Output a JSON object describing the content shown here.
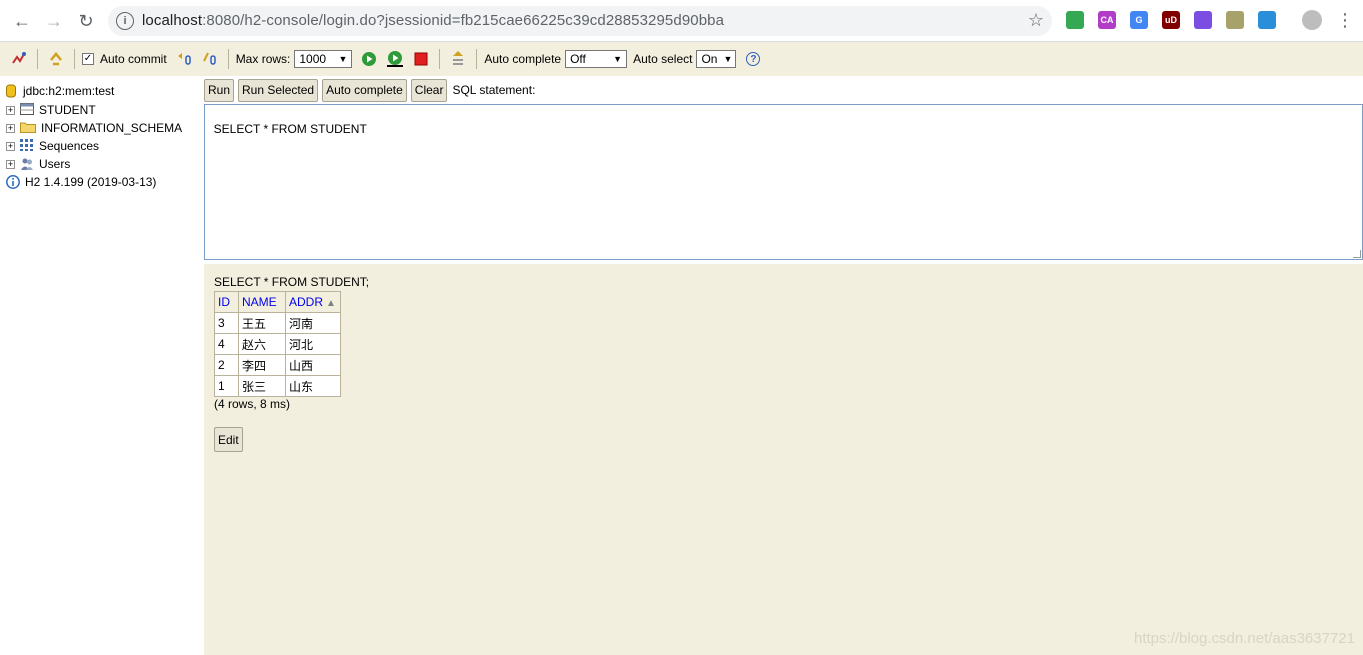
{
  "browser": {
    "url_host": "localhost",
    "url_rest": ":8080/h2-console/login.do?jsessionid=fb215cae66225c39cd28853295d90bba",
    "extensions": [
      {
        "name": "drive-extension-icon",
        "color": "#34a853",
        "label": ""
      },
      {
        "name": "ca-extension-icon",
        "color": "#b03cc8",
        "label": "CA"
      },
      {
        "name": "translate-extension-icon",
        "color": "#4285f4",
        "label": "G"
      },
      {
        "name": "ublock-extension-icon",
        "color": "#800000",
        "label": "uD"
      },
      {
        "name": "shield-extension-icon",
        "color": "#7b4de2",
        "label": ""
      },
      {
        "name": "notes-extension-icon",
        "color": "#a7a26a",
        "label": ""
      },
      {
        "name": "video-extension-icon",
        "color": "#2a8fd8",
        "label": ""
      }
    ]
  },
  "toolbar": {
    "auto_commit_label": "Auto commit",
    "max_rows_label": "Max rows:",
    "max_rows_value": "1000",
    "auto_complete_label": "Auto complete",
    "auto_complete_value": "Off",
    "auto_select_label": "Auto select",
    "auto_select_value": "On",
    "help_glyph": "?"
  },
  "tree": {
    "connection": "jdbc:h2:mem:test",
    "items": [
      {
        "label": "STUDENT"
      },
      {
        "label": "INFORMATION_SCHEMA"
      },
      {
        "label": "Sequences"
      },
      {
        "label": "Users"
      }
    ],
    "version": "H2 1.4.199 (2019-03-13)"
  },
  "query": {
    "run_label": "Run",
    "run_selected_label": "Run Selected",
    "auto_complete_label": "Auto complete",
    "clear_label": "Clear",
    "sql_statement_label": "SQL statement:",
    "sql_text": "SELECT * FROM STUDENT"
  },
  "result": {
    "executed_sql": "SELECT * FROM STUDENT;",
    "columns": [
      "ID",
      "NAME",
      "ADDR"
    ],
    "sort_glyph": "▲",
    "rows": [
      [
        "3",
        "王五",
        "河南"
      ],
      [
        "4",
        "赵六",
        "河北"
      ],
      [
        "2",
        "李四",
        "山西"
      ],
      [
        "1",
        "张三",
        "山东"
      ]
    ],
    "summary": "(4 rows, 8 ms)",
    "edit_label": "Edit"
  },
  "watermark": "https://blog.csdn.net/aas3637721",
  "colors": {
    "panel_bg": "#f3efdf",
    "link_blue": "#0000ee",
    "editor_border": "#7a9cc6"
  }
}
